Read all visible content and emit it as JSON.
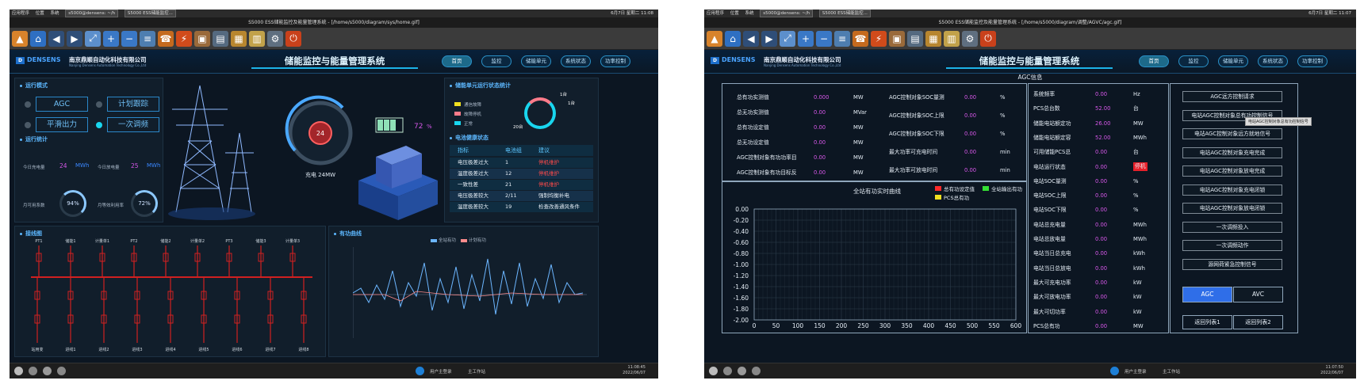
{
  "w1": {
    "topbar": {
      "apps": "应用程序",
      "pos": "位置",
      "sys": "系统",
      "tab1": "s5000@densens: ~/h",
      "tab2": "S5000 ESS储能监控...",
      "right": "6月7日 星期二 11:08"
    },
    "title": "S5000 ESS储能监控及能量管理系统 - [/home/s5000/diagram/sys/home.gif]",
    "logo": "DENSENS",
    "company": "南京鼎顺自动化科技有限公司",
    "company_en": "Nanjing Densens Automation Technology Co.,Ltd",
    "system_title": "储能监控与能量管理系统",
    "nav": [
      "首页",
      "监控",
      "储能单元",
      "系统状态",
      "功率控制"
    ],
    "mode": {
      "title": "运行模式",
      "buttons": [
        "AGC",
        "计划跟踪",
        "平滑出力",
        "一次调频"
      ]
    },
    "stats": {
      "title": "运行统计",
      "charge_label": "今日充电量",
      "charge_val": "24",
      "charge_unit": "MWh",
      "discharge_label": "今日放电量",
      "discharge_val": "25",
      "discharge_unit": "MWh",
      "avail_label": "月可用系数",
      "avail_val": "94%",
      "eq_label": "月等效利用率",
      "eq_val": "72%"
    },
    "gauge": {
      "value": "24",
      "caption": "充电 24MW"
    },
    "battery": {
      "pct": "72",
      "unit": "%"
    },
    "unit_stats": {
      "title": "储能单元运行状态统计",
      "legend": [
        "通信故障",
        "故障停机",
        "正常"
      ],
      "labels": [
        "1台",
        "1台",
        "20台"
      ]
    },
    "health": {
      "title": "电池健康状态",
      "headers": [
        "指标",
        "电池组",
        "建议"
      ],
      "rows": [
        [
          "电压极差过大",
          "1",
          "停机维护"
        ],
        [
          "温度极差过大",
          "12",
          "停机维护"
        ],
        [
          "一致性差",
          "21",
          "停机维护"
        ],
        [
          "电压极差较大",
          "2/11",
          "强制均衡补电"
        ],
        [
          "温度极差较大",
          "19",
          "检查改善通风条件"
        ]
      ]
    },
    "wiring": {
      "title": "接线图",
      "buses": [
        "PT1",
        "储能1",
        "计量单1",
        "PT2",
        "储能2",
        "计量单2",
        "PT3",
        "储能3",
        "计量单3"
      ],
      "feeders": [
        "站用变",
        "进线1",
        "进线2",
        "进线3",
        "进线4",
        "进线5",
        "进线6",
        "进线7",
        "进线8"
      ]
    },
    "curve": {
      "title": "有功曲线",
      "legend": [
        "全站有功",
        "计划有功"
      ]
    },
    "taskbar": {
      "user": "用户主登录",
      "tool": "主工作站",
      "time": "11:08:45",
      "date": "2022/06/07"
    }
  },
  "w2": {
    "topbar": {
      "apps": "应用程序",
      "pos": "位置",
      "sys": "系统",
      "tab1": "s5000@densens: ~/h",
      "tab2": "S5000 ESS储能监控...",
      "right": "6月7日 星期二 11:07"
    },
    "title": "S5000 ESS储能监控及能量管理系统 - [/home/s5000/diagram/调整/AGVC/agc.gif]",
    "logo": "DENSENS",
    "company": "南京鼎顺自动化科技有限公司",
    "company_en": "Nanjing Densens Automation Technology Co.,Ltd",
    "system_title": "储能监控与能量管理系统",
    "nav": [
      "首页",
      "监控",
      "储能单元",
      "系统状态",
      "功率控制"
    ],
    "agc_title": "AGC信息",
    "left": [
      {
        "label": "总有功实测值",
        "val": "0.000",
        "unit": "MW"
      },
      {
        "label": "总无功实测值",
        "val": "0.00",
        "unit": "MVar"
      },
      {
        "label": "总有功设定值",
        "val": "0.00",
        "unit": "MW"
      },
      {
        "label": "总无功设定值",
        "val": "0.00",
        "unit": "MW"
      },
      {
        "label": "AGC控制对象有功功率目",
        "val": "0.00",
        "unit": "MW"
      },
      {
        "label": "AGC控制对象有功目标反",
        "val": "0.00",
        "unit": "MW"
      }
    ],
    "mid": [
      {
        "label": "AGC控制对象SOC量测",
        "val": "0.00",
        "unit": "%"
      },
      {
        "label": "AGC控制对象SOC上限",
        "val": "0.00",
        "unit": "%"
      },
      {
        "label": "AGC控制对象SOC下限",
        "val": "0.00",
        "unit": "%"
      },
      {
        "label": "最大功率可充电时间",
        "val": "0.00",
        "unit": "min"
      },
      {
        "label": "最大功率可放电时间",
        "val": "0.00",
        "unit": "min"
      }
    ],
    "right": [
      {
        "label": "系统频率",
        "val": "0.00",
        "unit": "Hz"
      },
      {
        "label": "PCS总台数",
        "val": "52.00",
        "unit": "台"
      },
      {
        "label": "储能电站额定功",
        "val": "26.00",
        "unit": "MW"
      },
      {
        "label": "储能电站额定容",
        "val": "52.00",
        "unit": "MWh"
      },
      {
        "label": "可用储能PCS总",
        "val": "0.00",
        "unit": "台"
      },
      {
        "label": "电站运行状态",
        "val": "0.00",
        "unit": "停机"
      },
      {
        "label": "电站SOC量测",
        "val": "0.00",
        "unit": "%"
      },
      {
        "label": "电站SOC上限",
        "val": "0.00",
        "unit": "%"
      },
      {
        "label": "电站SOC下限",
        "val": "0.00",
        "unit": "%"
      },
      {
        "label": "电站总充电量",
        "val": "0.00",
        "unit": "MWh"
      },
      {
        "label": "电站总放电量",
        "val": "0.00",
        "unit": "MWh"
      },
      {
        "label": "电站当日总充电",
        "val": "0.00",
        "unit": "kWh"
      },
      {
        "label": "电站当日总放电",
        "val": "0.00",
        "unit": "kWh"
      },
      {
        "label": "最大可充电功率",
        "val": "0.00",
        "unit": "kW"
      },
      {
        "label": "最大可放电功率",
        "val": "0.00",
        "unit": "kW"
      },
      {
        "label": "最大可切功率",
        "val": "0.00",
        "unit": "kW"
      },
      {
        "label": "PCS总有功",
        "val": "0.00",
        "unit": "MW"
      }
    ],
    "buttons": [
      "AGC远方控制请求",
      "电站AGC控制对象总有功控制信号",
      "电站AGC控制对象远方就地信号",
      "电站AGC控制对象充电完成",
      "电站AGC控制对象放电完成",
      "电站AGC控制对象充电闭锁",
      "电站AGC控制对象放电闭锁",
      "一次调频投入",
      "一次调频动作",
      "源网荷紧急控制信号"
    ],
    "tooltip": "电站AGC控制对象总有功控制信号",
    "toggle": [
      "AGC",
      "AVC"
    ],
    "returns": [
      "返回列表1",
      "返回列表2"
    ],
    "taskbar": {
      "user": "用户主登录",
      "tool": "主工作站",
      "time": "11:07:50",
      "date": "2022/06/07"
    }
  },
  "chart_data": {
    "type": "line",
    "title": "全站有功实时曲线",
    "legend": [
      "总有功设定值",
      "全站输出有功",
      "PCS总有功"
    ],
    "colors": [
      "#ff2a2a",
      "#35e035",
      "#f0e020"
    ],
    "xlim": [
      0,
      600
    ],
    "ylim": [
      -2.0,
      0.0
    ],
    "xticks": [
      0,
      50,
      100,
      150,
      200,
      250,
      300,
      350,
      400,
      450,
      500,
      550,
      600
    ],
    "yticks": [
      "0.00",
      "-0.20",
      "-0.40",
      "-0.60",
      "-0.80",
      "-1.00",
      "-1.20",
      "-1.40",
      "-1.60",
      "-1.80",
      "-2.00"
    ],
    "series": []
  }
}
